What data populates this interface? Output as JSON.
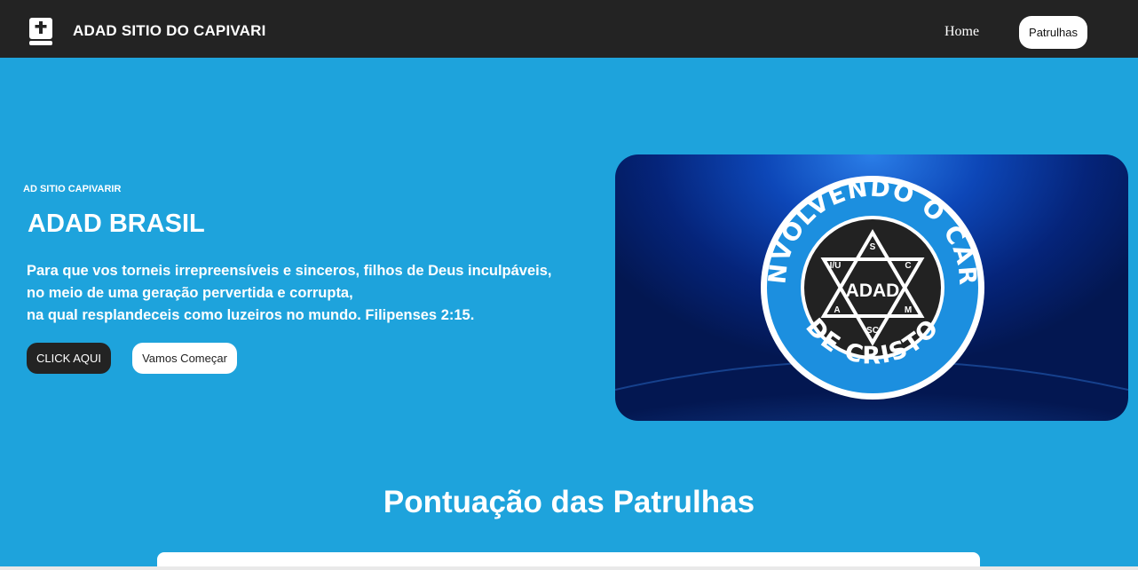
{
  "navbar": {
    "brand_icon": "bible-cross-icon",
    "brand_title": "ADAD SITIO DO CAPIVARI",
    "links": {
      "home": "Home",
      "patrulhas": "Patrulhas"
    }
  },
  "hero": {
    "kicker": "AD SITIO CAPIVARIR",
    "title": "ADAD BRASIL",
    "verse_lines": [
      "Para que vos torneis irrepreensíveis e sinceros, filhos de Deus inculpáveis,",
      "no meio de uma geração pervertida e corrupta,",
      "na qual resplandeceis como luzeiros no mundo. Filipenses 2:15."
    ],
    "buttons": {
      "primary": "CLICK AQUI",
      "secondary": "Vamos Começar"
    },
    "emblem": {
      "ring_text": "DESENVOLVENDO O CARÁTER DE CRISTO",
      "center": "ADAD",
      "points": [
        "S",
        "C",
        "M",
        "SC",
        "A",
        "I/U"
      ]
    }
  },
  "section": {
    "title": "Pontuação das Patrulhas"
  },
  "colors": {
    "background": "#1ea3dc",
    "navbar": "#232323",
    "button_dark": "#232323",
    "button_light": "#ffffff"
  }
}
